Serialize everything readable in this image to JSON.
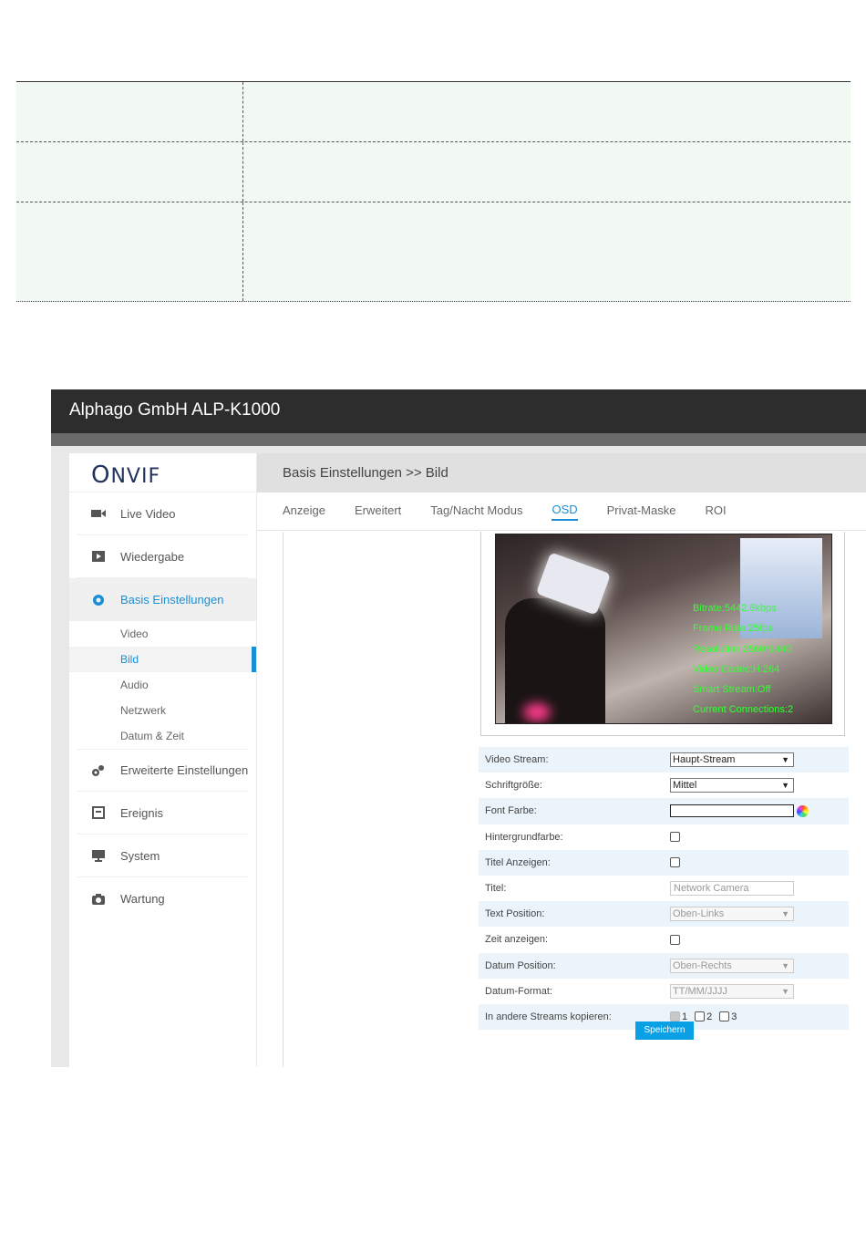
{
  "app": {
    "title": "Alphago GmbH ALP-K1000",
    "logo": "ONVIF"
  },
  "sidebar": {
    "items": [
      {
        "label": "Live Video",
        "icon": "video-camera-icon"
      },
      {
        "label": "Wiedergabe",
        "icon": "playback-icon"
      },
      {
        "label": "Basis Einstellungen",
        "icon": "gear-icon"
      },
      {
        "label": "Erweiterte Einstellungen",
        "icon": "gears-icon"
      },
      {
        "label": "Ereignis",
        "icon": "event-icon"
      },
      {
        "label": "System",
        "icon": "monitor-icon"
      },
      {
        "label": "Wartung",
        "icon": "camera-icon"
      }
    ],
    "sub_items": [
      "Video",
      "Bild",
      "Audio",
      "Netzwerk",
      "Datum & Zeit"
    ]
  },
  "main": {
    "breadcrumb": "Basis Einstellungen >> Bild",
    "tabs": [
      "Anzeige",
      "Erweitert",
      "Tag/Nacht Modus",
      "OSD",
      "Privat-Maske",
      "ROI"
    ]
  },
  "osd_overlay": [
    "Bitrate:5442.6kbps",
    "Frame Rate:25fps",
    "Resolution:2560*1440",
    "Video Codec:H.264",
    "Smart Stream:Off",
    "Current Connections:2"
  ],
  "form": {
    "video_stream": {
      "label": "Video Stream:",
      "value": "Haupt-Stream"
    },
    "font_size": {
      "label": "Schriftgröße:",
      "value": "Mittel"
    },
    "font_color": {
      "label": "Font Farbe:"
    },
    "bg_color": {
      "label": "Hintergrundfarbe:"
    },
    "show_title": {
      "label": "Titel Anzeigen:"
    },
    "title": {
      "label": "Titel:",
      "placeholder": "Network Camera"
    },
    "text_position": {
      "label": "Text Position:",
      "value": "Oben-Links"
    },
    "show_time": {
      "label": "Zeit anzeigen:"
    },
    "date_position": {
      "label": "Datum Position:",
      "value": "Oben-Rechts"
    },
    "date_format": {
      "label": "Datum-Format:",
      "value": "TT/MM/JJJJ"
    },
    "copy_streams": {
      "label": "In andere Streams kopieren:",
      "options": [
        "1",
        "2",
        "3"
      ]
    }
  },
  "save_label": "Speichern",
  "colors": {
    "accent": "#1a8fd6",
    "save": "#0aa0e6",
    "osd_text": "#33ff33"
  }
}
